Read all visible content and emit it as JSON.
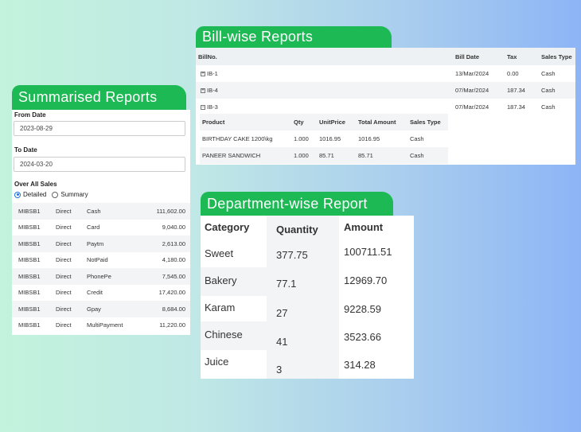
{
  "summarised": {
    "title": "Summarised Reports",
    "from_label": "From Date",
    "from_value": "2023-08-29",
    "to_label": "To Date",
    "to_value": "2024-03-20",
    "overall_label": "Over All Sales",
    "detailed_label": "Detailed",
    "summary_label": "Summary",
    "rows": [
      {
        "code": "MIBSB1",
        "type": "Direct",
        "mode": "Cash",
        "amount": "111,602.00"
      },
      {
        "code": "MIBSB1",
        "type": "Direct",
        "mode": "Card",
        "amount": "9,040.00"
      },
      {
        "code": "MIBSB1",
        "type": "Direct",
        "mode": "Paytm",
        "amount": "2,613.00"
      },
      {
        "code": "MIBSB1",
        "type": "Direct",
        "mode": "NotPaid",
        "amount": "4,180.00"
      },
      {
        "code": "MIBSB1",
        "type": "Direct",
        "mode": "PhonePe",
        "amount": "7,545.00"
      },
      {
        "code": "MIBSB1",
        "type": "Direct",
        "mode": "Credit",
        "amount": "17,420.00"
      },
      {
        "code": "MIBSB1",
        "type": "Direct",
        "mode": "Gpay",
        "amount": "8,684.00"
      },
      {
        "code": "MIBSB1",
        "type": "Direct",
        "mode": "MultiPayment",
        "amount": "11,220.00"
      }
    ]
  },
  "billwise": {
    "title": "Bill-wise Reports",
    "headers": {
      "billno": "BillNo.",
      "date": "Bill Date",
      "tax": "Tax",
      "sales_type": "Sales Type"
    },
    "bills": [
      {
        "sign": "+",
        "no": "IB-1",
        "date": "13/Mar/2024",
        "tax": "0.00",
        "sales_type": "Cash"
      },
      {
        "sign": "+",
        "no": "IB-4",
        "date": "07/Mar/2024",
        "tax": "187.34",
        "sales_type": "Cash"
      },
      {
        "sign": "−",
        "no": "IB-3",
        "date": "07/Mar/2024",
        "tax": "187.34",
        "sales_type": "Cash"
      }
    ],
    "sub_headers": {
      "product": "Product",
      "qty": "Qty",
      "unit_price": "UnitPrice",
      "total": "Total Amount",
      "sales_type": "Sales Type"
    },
    "items": [
      {
        "product": "BIRTHDAY CAKE 1200\\kg",
        "qty": "1.000",
        "unit_price": "1016.95",
        "total": "1016.95",
        "sales_type": "Cash"
      },
      {
        "product": "PANEER SANDWICH",
        "qty": "1.000",
        "unit_price": "85.71",
        "total": "85.71",
        "sales_type": "Cash"
      }
    ]
  },
  "department": {
    "title": "Department-wise Report",
    "headers": {
      "category": "Category",
      "quantity": "Quantity",
      "amount": "Amount"
    },
    "rows": [
      {
        "category": "Sweet",
        "quantity": "377.75",
        "amount": "100711.51"
      },
      {
        "category": "Bakery",
        "quantity": "77.1",
        "amount": "12969.70"
      },
      {
        "category": "Karam",
        "quantity": "27",
        "amount": "9228.59"
      },
      {
        "category": "Chinese",
        "quantity": "41",
        "amount": "3523.66"
      },
      {
        "category": "Juice",
        "quantity": "3",
        "amount": "314.28"
      }
    ]
  }
}
